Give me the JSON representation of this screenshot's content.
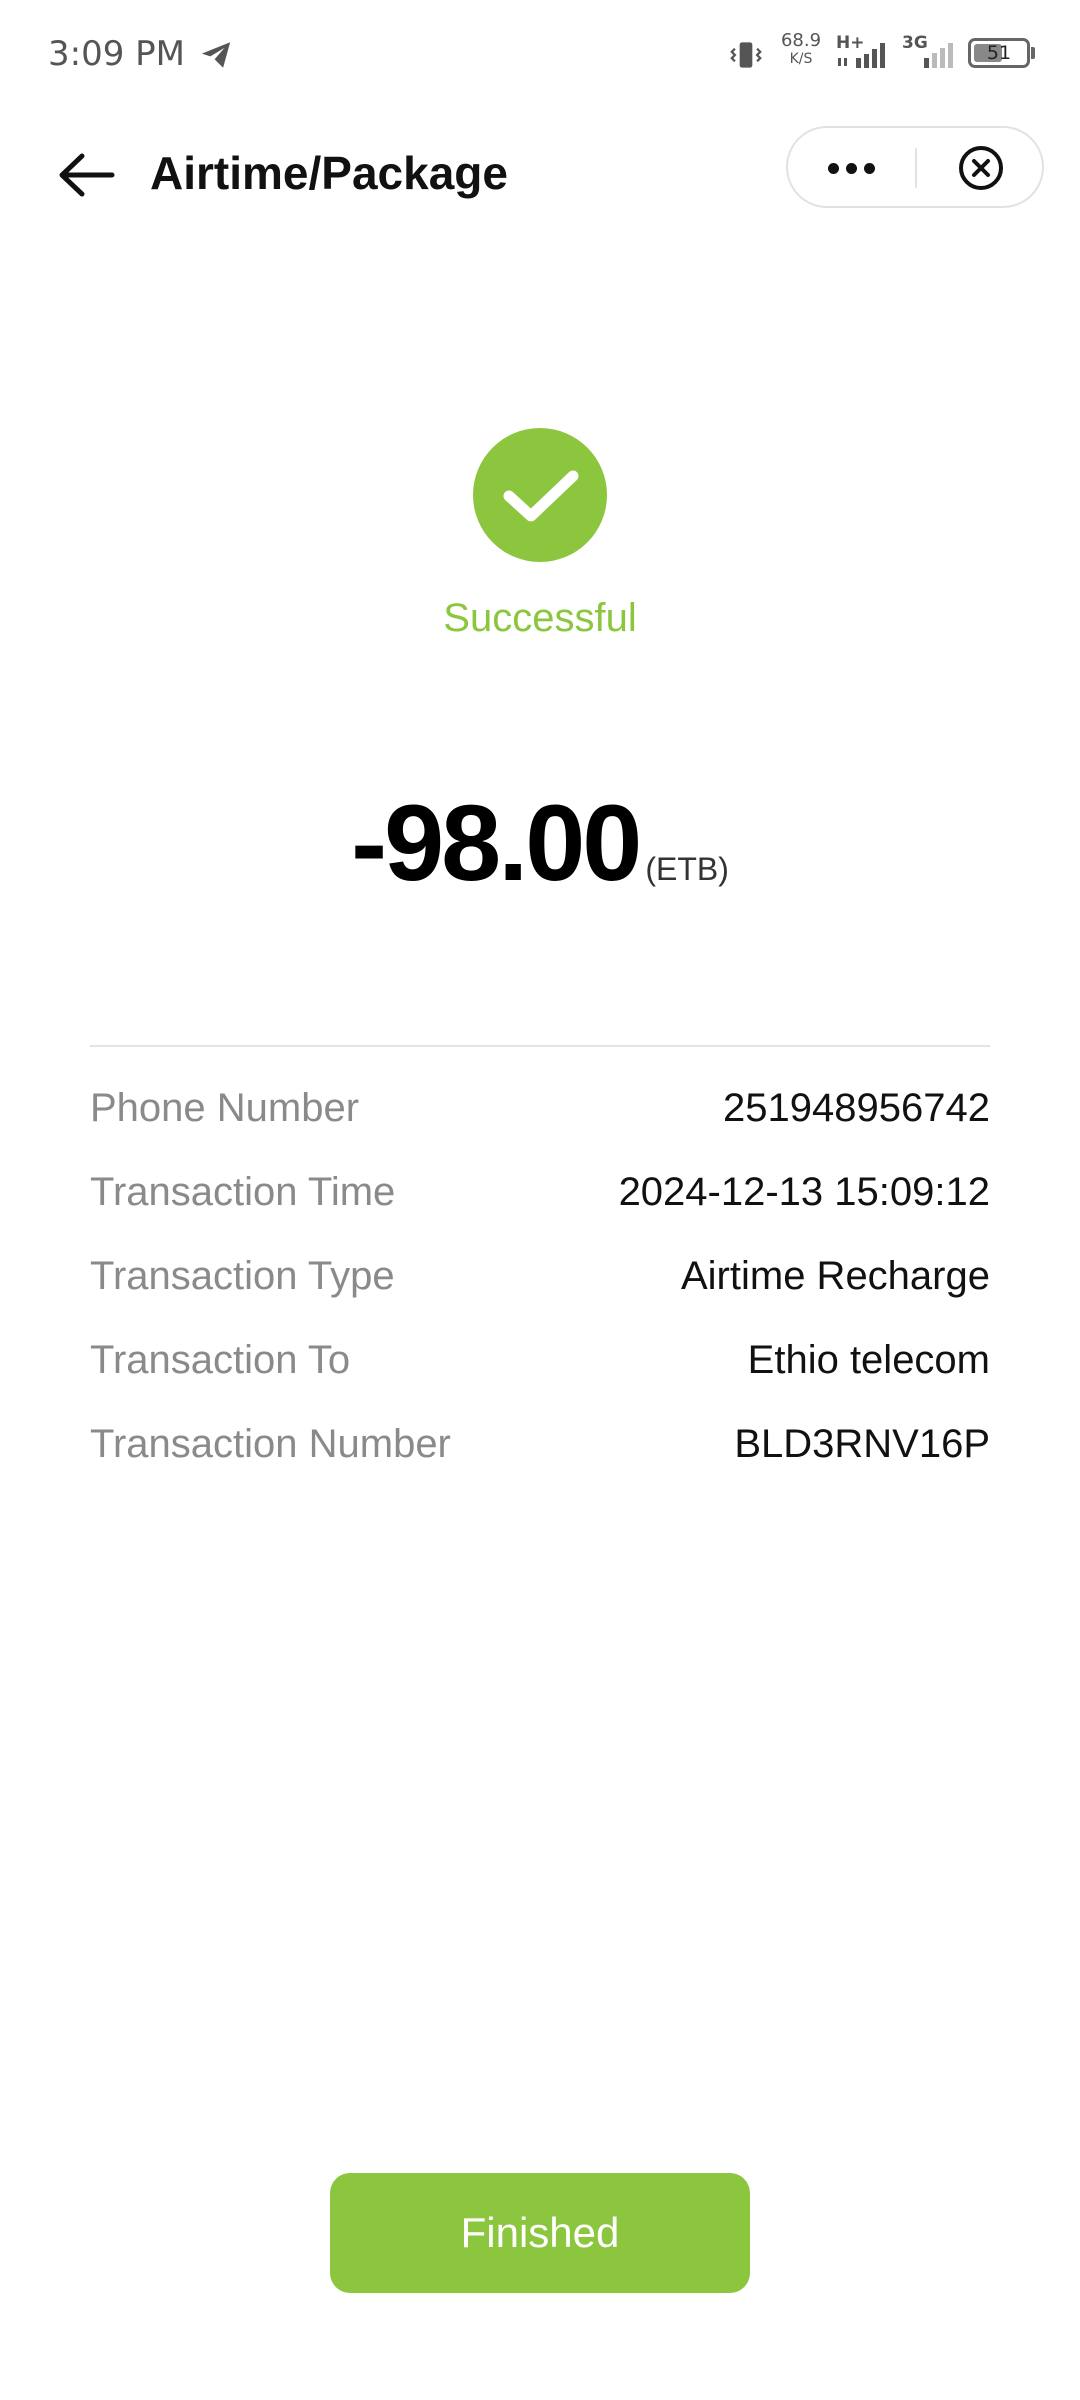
{
  "status_bar": {
    "time": "3:09 PM",
    "net_speed_value": "68.9",
    "net_speed_unit": "K/S",
    "network_1": "H+",
    "network_2": "3G",
    "battery": "51",
    "icons": [
      "telegram-icon",
      "vibrate-icon",
      "signal-icon",
      "battery-icon"
    ]
  },
  "header": {
    "title": "Airtime/Package",
    "icons": [
      "back-arrow-icon",
      "more-dots-icon",
      "close-circle-icon"
    ]
  },
  "result": {
    "status": "Successful",
    "icon": "check-circle-icon",
    "color": "#8cc63f"
  },
  "amount": {
    "value": "-98.00",
    "currency": "(ETB)"
  },
  "details": [
    {
      "label": "Phone Number",
      "value": "251948956742"
    },
    {
      "label": "Transaction Time",
      "value": "2024-12-13 15:09:12"
    },
    {
      "label": "Transaction Type",
      "value": "Airtime Recharge"
    },
    {
      "label": "Transaction To",
      "value": "Ethio telecom"
    },
    {
      "label": "Transaction Number",
      "value": "BLD3RNV16P"
    }
  ],
  "footer": {
    "finished_label": "Finished"
  }
}
